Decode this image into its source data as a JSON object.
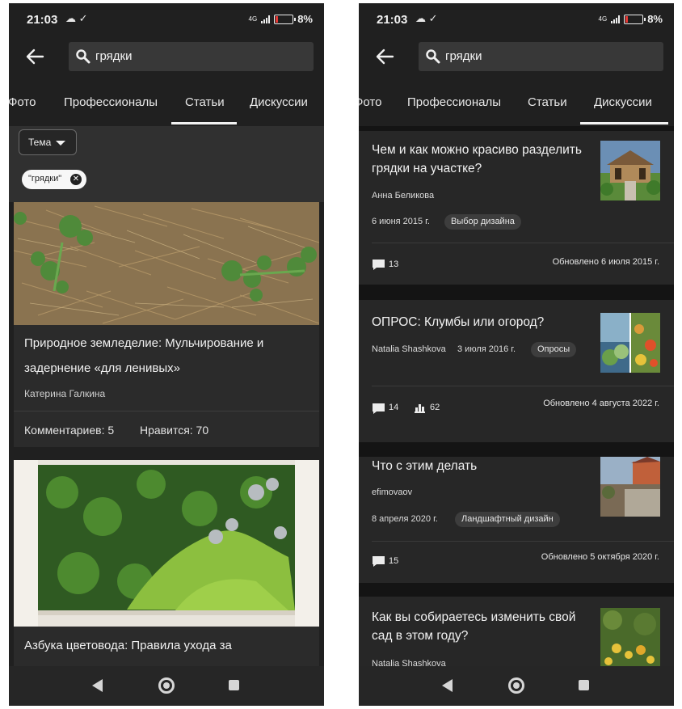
{
  "status_bar": {
    "time": "21:03",
    "network": "4G",
    "battery_pct": "8%",
    "battery_color": "#e53935"
  },
  "search": {
    "query": "грядки"
  },
  "tabs": [
    "Фото",
    "Профессионалы",
    "Статьи",
    "Дискуссии"
  ],
  "left_screen": {
    "active_tab": "Статьи",
    "filter": {
      "topic_label": "Тема",
      "chip": "\"грядки\""
    },
    "articles": [
      {
        "title": "Природное земледелие: Мульчирование и задернение «для ленивых»",
        "author": "Катерина Галкина",
        "comments": "Комментариев: 5",
        "likes": "Нравится: 70"
      },
      {
        "title": "Азбука цветовода: Правила ухода за"
      }
    ]
  },
  "right_screen": {
    "active_tab": "Дискуссии",
    "discussions": [
      {
        "title": "Чем и как можно красиво разделить грядки на участке?",
        "author": "Анна Беликова",
        "date": "6 июня 2015 г.",
        "tag": "Выбор дизайна",
        "comments": "13",
        "updated": "Обновлено 6 июля 2015 г."
      },
      {
        "title": "ОПРОС: Клумбы или огород?",
        "author": "Natalia Shashkova",
        "date": "3 июля 2016 г.",
        "tag": "Опросы",
        "comments": "14",
        "votes": "62",
        "updated": "Обновлено 4 августа 2022 г."
      },
      {
        "title": "Что с этим делать",
        "author": "efimovaov",
        "date": "8 апреля 2020 г.",
        "tag": "Ландшафтный дизайн",
        "comments": "15",
        "updated": "Обновлено 5 октября 2020 г."
      },
      {
        "title": "Как вы собираетесь изменить свой сад в этом году?",
        "author": "Natalia Shashkova"
      }
    ]
  },
  "colors": {
    "background": "#202020",
    "card": "#2b2b2b",
    "feed_gap": "#141414",
    "accent_text": "#f2f2f2"
  }
}
